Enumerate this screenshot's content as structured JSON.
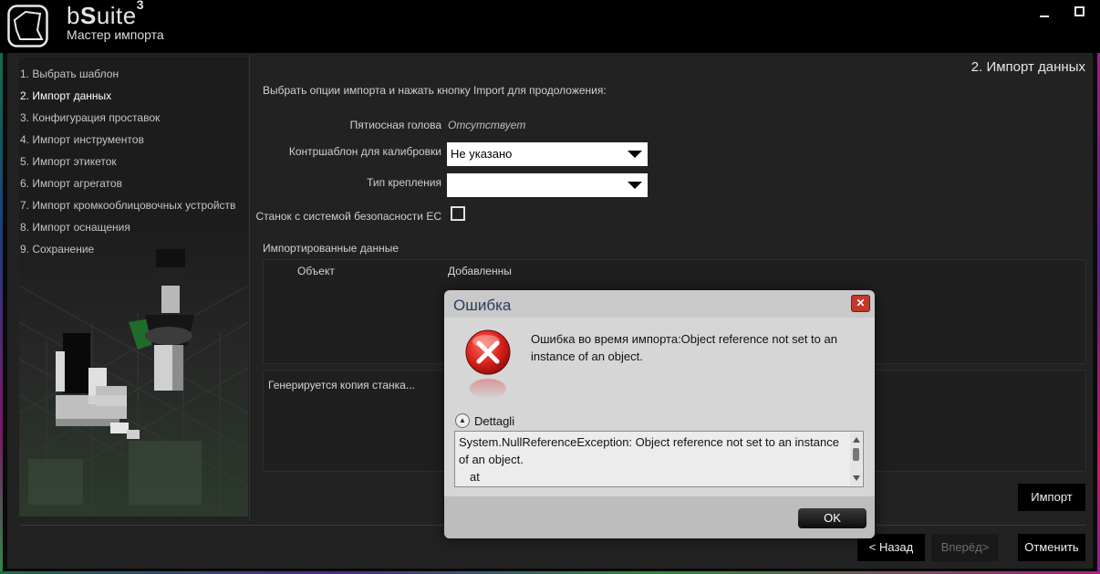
{
  "window": {
    "brand_prefix": "b",
    "brand_bold": "S",
    "brand_suffix": "uite",
    "brand_version": "3",
    "subtitle": "Мастер импорта",
    "minimize_icon": "minimize-icon",
    "maximize_icon": "maximize-icon"
  },
  "steps": [
    {
      "label": "1. Выбрать шаблон",
      "active": false
    },
    {
      "label": "2. Импорт данных",
      "active": true
    },
    {
      "label": "3. Конфигурация проставок",
      "active": false
    },
    {
      "label": "4. Импорт инструментов",
      "active": false
    },
    {
      "label": "5. Импорт этикеток",
      "active": false
    },
    {
      "label": "6. Импорт агрегатов",
      "active": false
    },
    {
      "label": "7. Импорт кромкооблицовочных устройств",
      "active": false
    },
    {
      "label": "8. Импорт оснащения",
      "active": false
    },
    {
      "label": "9. Сохранение",
      "active": false
    }
  ],
  "page": {
    "heading": "2. Импорт данных",
    "instruction": "Выбрать опции импорта и нажать кнопку Import для продоложения:"
  },
  "form": {
    "five_axis_label": "Пятиосная голова",
    "five_axis_value": "Отсутствует",
    "calibration_label": "Контршаблон для калибровки",
    "calibration_value": "Не указано",
    "mount_label": "Тип крепления",
    "mount_value": "",
    "safety_label": "Станок с системой безопасности ЕС",
    "safety_checked": false
  },
  "imported": {
    "label": "Импортированные данные",
    "columns": [
      "Объект",
      "Добавленны"
    ]
  },
  "log": {
    "text": "Генерируется копия станка..."
  },
  "buttons": {
    "import": "Импорт",
    "back": "< Назад",
    "next": "Вперёд>",
    "cancel": "Отменить"
  },
  "dialog": {
    "title": "Ошибка",
    "message": "Ошибка во время импорта:Object reference not set to an instance of an object.",
    "details_label": "Dettagli",
    "details_text_line1": "System.NullReferenceException: Object reference not set to an instance of an object.",
    "details_text_line2": "at",
    "ok": "OK",
    "close_glyph": "✕",
    "toggle_glyph": "▲"
  },
  "colors": {
    "accent_error": "#c0392b",
    "background": "#222222",
    "dialog_title": "#2a3c60"
  }
}
